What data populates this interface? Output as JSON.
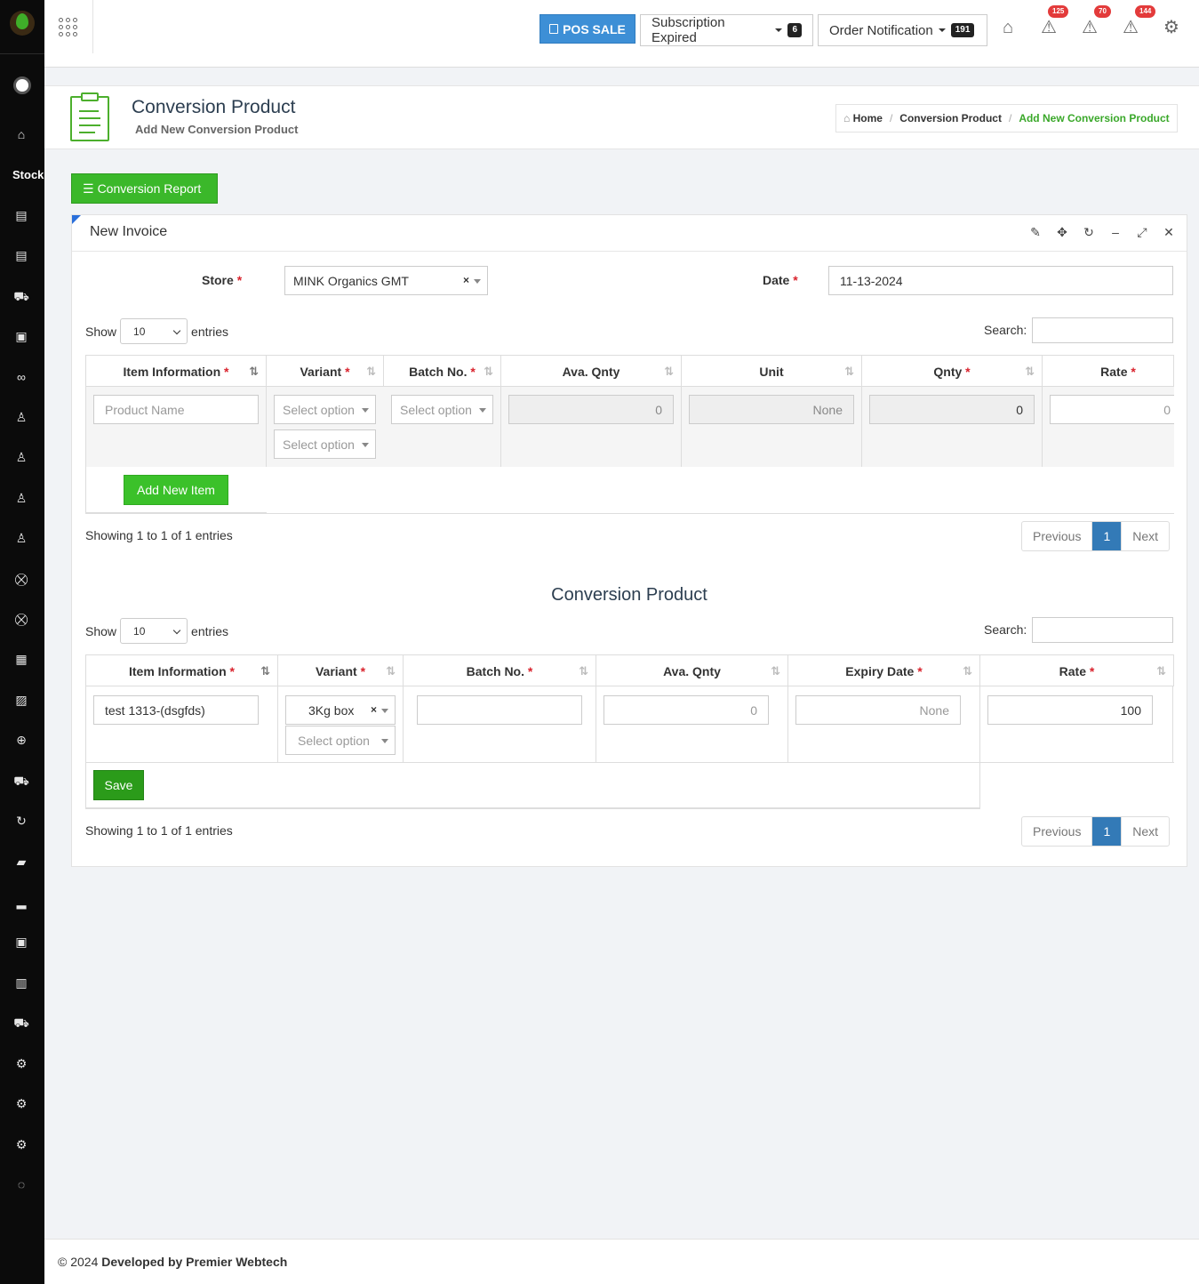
{
  "sidebar": {
    "section_label": "Stock",
    "icons": [
      "home-icon",
      "tag-icon",
      "tag-icon",
      "truck-icon",
      "bag-icon",
      "handshake-icon",
      "user-icon",
      "user-icon",
      "user-icon",
      "user-icon",
      "cart-icon",
      "cart-icon",
      "calendar-icon",
      "image-icon",
      "crosshair-icon",
      "truck-icon",
      "refresh-icon",
      "book-icon",
      "chart-icon",
      "briefcase-icon",
      "book-open-icon",
      "truck-icon",
      "gear-icon",
      "gear-icon",
      "gear-icon",
      "chat-icon"
    ]
  },
  "topbar": {
    "pos_sale_label": "POS SALE",
    "subscription_label": "Subscription Expired",
    "subscription_count": "6",
    "order_notification_label": "Order Notification",
    "order_notification_count": "191",
    "alert_badges": [
      "125",
      "70",
      "144"
    ]
  },
  "page_header": {
    "title": "Conversion Product",
    "subtitle": "Add New Conversion Product",
    "breadcrumb": {
      "home": "Home",
      "parent": "Conversion Product",
      "current": "Add New Conversion Product"
    }
  },
  "actions": {
    "conversion_report_label": "Conversion Report"
  },
  "panel": {
    "title": "New Invoice",
    "store_label": "Store",
    "store_value": "MINK Organics GMT",
    "date_label": "Date",
    "date_value": "11-13-2024",
    "required_mark": "*"
  },
  "table1": {
    "show_label": "Show",
    "entries_label": "entries",
    "length_value": "10",
    "search_label": "Search:",
    "columns": [
      "Item Information",
      "Variant",
      "Batch No.",
      "Ava. Qnty",
      "Unit",
      "Qnty",
      "Rate"
    ],
    "row": {
      "product_placeholder": "Product Name",
      "variant_placeholder_1": "Select option",
      "variant_placeholder_2": "Select option",
      "batch_placeholder": "Select option",
      "ava_qnty": "0",
      "unit": "None",
      "qnty": "0",
      "rate": "0"
    },
    "add_item_label": "Add New Item",
    "info": "Showing 1 to 1 of 1 entries",
    "pager": {
      "previous": "Previous",
      "page": "1",
      "next": "Next"
    }
  },
  "table2": {
    "section_title": "Conversion Product",
    "show_label": "Show",
    "entries_label": "entries",
    "length_value": "10",
    "search_label": "Search:",
    "columns": [
      "Item Information",
      "Variant",
      "Batch No.",
      "Ava. Qnty",
      "Expiry Date",
      "Rate"
    ],
    "row": {
      "item": "test 1313-(dsgfds)",
      "variant": "3Kg box",
      "variant_placeholder": "Select option",
      "batch": "",
      "ava_qnty": "0",
      "expiry": "None",
      "rate": "100"
    },
    "save_label": "Save",
    "info": "Showing 1 to 1 of 1 entries",
    "pager": {
      "previous": "Previous",
      "page": "1",
      "next": "Next"
    }
  },
  "footer": {
    "copyright": "© 2024",
    "developer": "Developed by Premier Webtech"
  }
}
